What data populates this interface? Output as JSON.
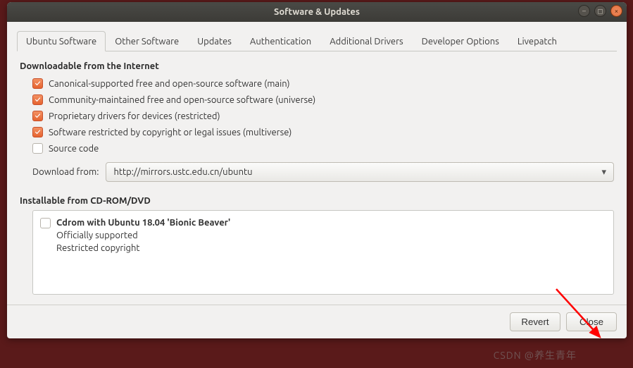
{
  "window": {
    "title": "Software & Updates"
  },
  "tabs": [
    {
      "label": "Ubuntu Software",
      "active": true
    },
    {
      "label": "Other Software"
    },
    {
      "label": "Updates"
    },
    {
      "label": "Authentication"
    },
    {
      "label": "Additional Drivers"
    },
    {
      "label": "Developer Options"
    },
    {
      "label": "Livepatch"
    }
  ],
  "sections": {
    "internet": {
      "heading": "Downloadable from the Internet",
      "items": [
        {
          "label": "Canonical-supported free and open-source software (main)",
          "checked": true
        },
        {
          "label": "Community-maintained free and open-source software (universe)",
          "checked": true
        },
        {
          "label": "Proprietary drivers for devices (restricted)",
          "checked": true
        },
        {
          "label": "Software restricted by copyright or legal issues (multiverse)",
          "checked": true
        },
        {
          "label": "Source code",
          "checked": false
        }
      ],
      "download_label": "Download from:",
      "download_value": "http://mirrors.ustc.edu.cn/ubuntu"
    },
    "cdrom": {
      "heading": "Installable from CD-ROM/DVD",
      "item": {
        "checked": false,
        "title": "Cdrom with Ubuntu 18.04 'Bionic Beaver'",
        "line1": "Officially supported",
        "line2": "Restricted copyright"
      }
    }
  },
  "buttons": {
    "revert": "Revert",
    "close": "Close"
  },
  "watermark": "CSDN @养生青年"
}
